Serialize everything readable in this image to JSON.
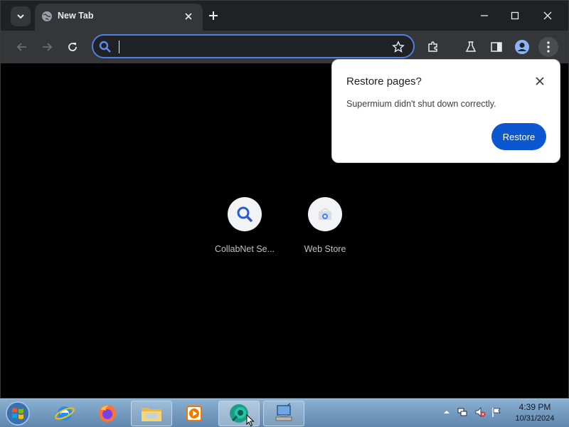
{
  "browser": {
    "tab": {
      "title": "New Tab"
    },
    "omnibox": {
      "value": "",
      "placeholder": ""
    },
    "shortcuts": [
      {
        "label": "CollabNet Se...",
        "icon": "search-icon"
      },
      {
        "label": "Web Store",
        "icon": "web-store-icon"
      }
    ]
  },
  "popup": {
    "title": "Restore pages?",
    "message": "Supermium didn't shut down correctly.",
    "button_label": "Restore"
  },
  "taskbar": {
    "time": "4:39 PM",
    "date": "10/31/2024"
  },
  "colors": {
    "accent": "#0b57d0",
    "omnibox_border": "#4f80e0",
    "toolbar": "#35363a",
    "titlebar": "#202124"
  }
}
